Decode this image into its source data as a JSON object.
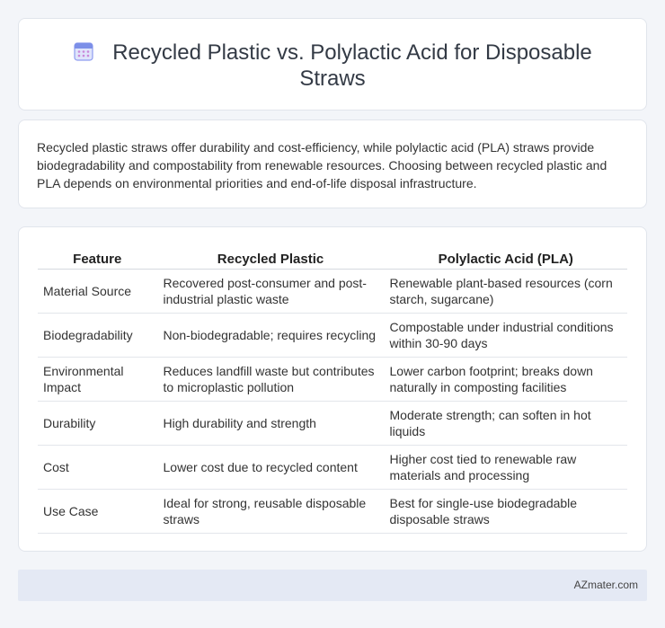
{
  "header": {
    "title": "Recycled Plastic vs. Polylactic Acid for Disposable Straws",
    "icon": "calendar-icon"
  },
  "intro": {
    "text": "Recycled plastic straws offer durability and cost-efficiency, while polylactic acid (PLA) straws provide biodegradability and compostability from renewable resources. Choosing between recycled plastic and PLA depends on environmental priorities and end-of-life disposal infrastructure."
  },
  "table": {
    "headers": [
      "Feature",
      "Recycled Plastic",
      "Polylactic Acid (PLA)"
    ],
    "rows": [
      [
        "Material Source",
        "Recovered post-consumer and post-industrial plastic waste",
        "Renewable plant-based resources (corn starch, sugarcane)"
      ],
      [
        "Biodegradability",
        "Non-biodegradable; requires recycling",
        "Compostable under industrial conditions within 30-90 days"
      ],
      [
        "Environmental Impact",
        "Reduces landfill waste but contributes to microplastic pollution",
        "Lower carbon footprint; breaks down naturally in composting facilities"
      ],
      [
        "Durability",
        "High durability and strength",
        "Moderate strength; can soften in hot liquids"
      ],
      [
        "Cost",
        "Lower cost due to recycled content",
        "Higher cost tied to renewable raw materials and processing"
      ],
      [
        "Use Case",
        "Ideal for strong, reusable disposable straws",
        "Best for single-use biodegradable disposable straws"
      ]
    ]
  },
  "footer": {
    "brand": "AZmater.com"
  },
  "colors": {
    "page_bg": "#f3f5f9",
    "card_bg": "#ffffff",
    "footer_bg": "#e4e9f4",
    "icon_accent": "#7c8fe8"
  }
}
